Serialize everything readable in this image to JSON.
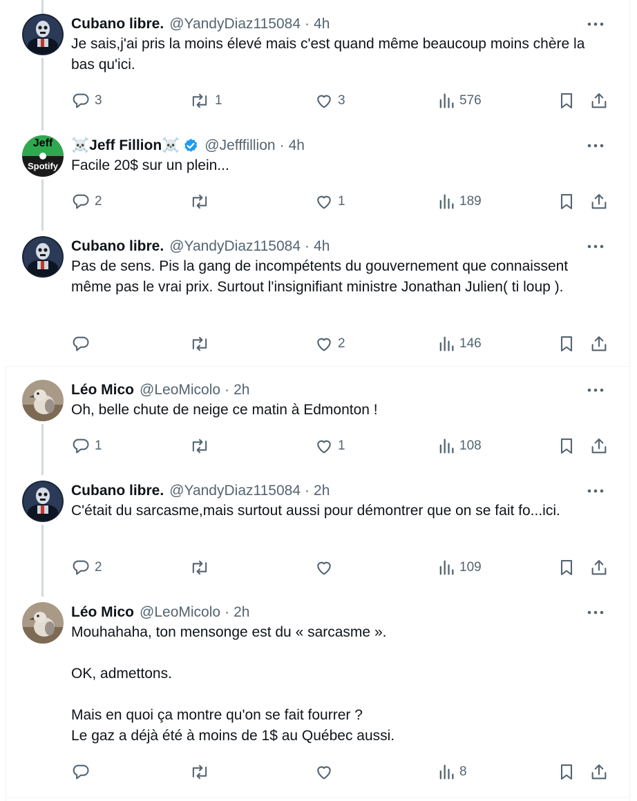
{
  "tweets": [
    {
      "name": "Cubano libre.",
      "handle": "@YandyDiaz115084",
      "time": "4h",
      "text": "Je sais,j'ai pris la moins élevé mais c'est quand même beaucoup moins chère la bas qu'ici.",
      "replies": "3",
      "retweets": "1",
      "likes": "3",
      "views": "576"
    },
    {
      "name": "☠️Jeff Fillion☠️",
      "handle": "@Jefffillion",
      "time": "4h",
      "text": "Facile 20$ sur un plein...",
      "replies": "2",
      "retweets": "",
      "likes": "1",
      "views": "189",
      "verified": true,
      "avatar_text": {
        "top": "Jeff",
        "bottom": "Spotify"
      }
    },
    {
      "name": "Cubano libre.",
      "handle": "@YandyDiaz115084",
      "time": "4h",
      "text": "Pas de sens. Pis la gang de incompétents du gouvernement que connaissent même pas le vrai prix. Surtout l'insignifiant ministre Jonathan Julien( ti loup ).",
      "replies": "",
      "retweets": "",
      "likes": "2",
      "views": "146"
    },
    {
      "name": "Léo Mico",
      "handle": "@LeoMicolo",
      "time": "2h",
      "text": "Oh, belle chute de neige ce matin à Edmonton !",
      "replies": "1",
      "retweets": "",
      "likes": "1",
      "views": "108"
    },
    {
      "name": "Cubano libre.",
      "handle": "@YandyDiaz115084",
      "time": "2h",
      "text": "C'était du sarcasme,mais surtout aussi pour démontrer que on se fait fo...ici.",
      "replies": "2",
      "retweets": "",
      "likes": "",
      "views": "109"
    },
    {
      "name": "Léo Mico",
      "handle": "@LeoMicolo",
      "time": "2h",
      "text": "Mouhahaha, ton mensonge est du « sarcasme ».\n\nOK, admettons.\n\nMais en quoi ça montre qu'on se fait fourrer ?\nLe gaz a déjà été à moins de 1$ au Québec aussi.",
      "replies": "",
      "retweets": "",
      "likes": "",
      "views": "8"
    }
  ],
  "colors": {
    "text": "#0f1419",
    "secondary": "#536471",
    "connector": "#cfd9de",
    "verified": "#1d9bf0",
    "separator": "#eff3f4"
  }
}
